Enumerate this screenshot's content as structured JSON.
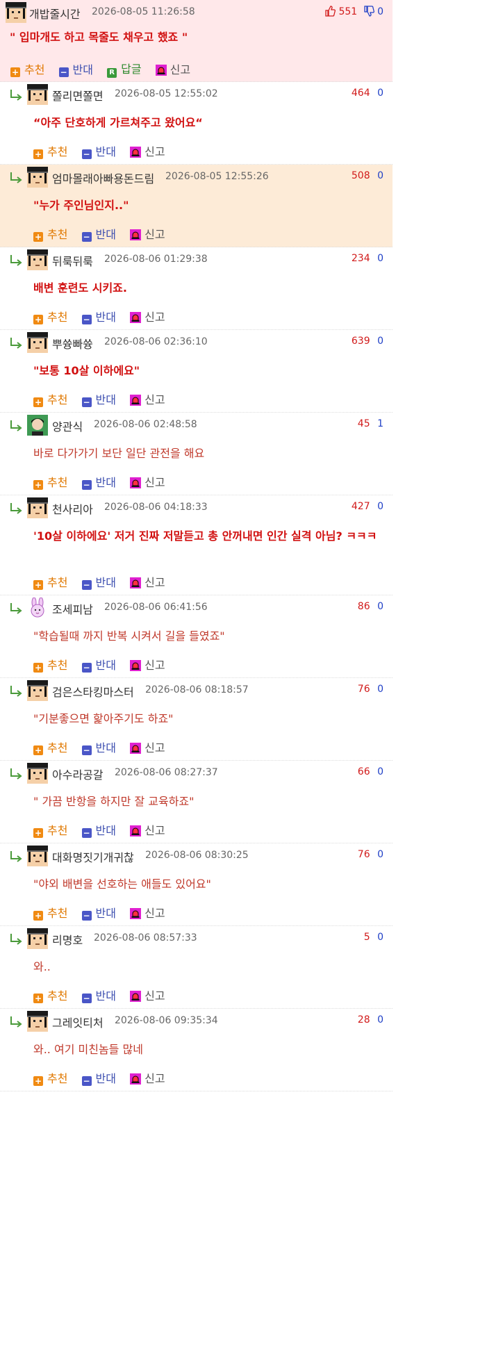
{
  "actions": {
    "recommend": "추천",
    "oppose": "반대",
    "reply": "답글",
    "report": "신고"
  },
  "comments": [
    {
      "type": "top",
      "nick": "개밥줄시간",
      "date": "2026-08-05 11:26:58",
      "up": "551",
      "down": "0",
      "text": "\" 입마개도 하고 목줄도 채우고 했죠 \"",
      "bold": true,
      "avatar": "default-avatar-icon"
    },
    {
      "type": "reply",
      "nick": "쫄리면쫄면",
      "date": "2026-08-05 12:55:02",
      "up": "464",
      "down": "0",
      "text": "“아주 단호하게 가르쳐주고 왔어요“",
      "bold": true,
      "avatar": "default-avatar-icon"
    },
    {
      "type": "reply",
      "nick": "엄마몰래아빠용돈드림",
      "date": "2026-08-05 12:55:26",
      "up": "508",
      "down": "0",
      "text": "\"누가 주인님인지..\"",
      "bold": true,
      "highlight": true,
      "avatar": "default-avatar-icon"
    },
    {
      "type": "reply",
      "nick": "뒤룩뒤룩",
      "date": "2026-08-06 01:29:38",
      "up": "234",
      "down": "0",
      "text": "배변 훈련도 시키죠.",
      "bold": true,
      "avatar": "default-avatar-icon"
    },
    {
      "type": "reply",
      "nick": "뿌쓩빠쓩",
      "date": "2026-08-06 02:36:10",
      "up": "639",
      "down": "0",
      "text": "\"보통 10살 이하에요\"",
      "bold": true,
      "avatar": "default-avatar-icon"
    },
    {
      "type": "reply",
      "nick": "양관식",
      "date": "2026-08-06 02:48:58",
      "up": "45",
      "down": "1",
      "text": "바로 다가가기 보단 일단 관전을 해요",
      "bold": false,
      "avatar": "photo-avatar-icon"
    },
    {
      "type": "reply",
      "nick": "천사리아",
      "date": "2026-08-06 04:18:33",
      "up": "427",
      "down": "0",
      "text": "'10살 이하에요' 저거 진짜 저말듣고 총 안꺼내면 인간 실격 아님? ㅋㅋㅋㅋㅋ",
      "bold": true,
      "twoLine": true,
      "avatar": "default-avatar-icon"
    },
    {
      "type": "reply",
      "nick": "조세피남",
      "date": "2026-08-06 06:41:56",
      "up": "86",
      "down": "0",
      "text": "\"학습될때 까지 반복 시켜서 길을 들였죠\"",
      "bold": false,
      "avatar": "bunny-avatar-icon"
    },
    {
      "type": "reply",
      "nick": "검은스타킹마스터",
      "date": "2026-08-06 08:18:57",
      "up": "76",
      "down": "0",
      "text": "\"기분좋으면 핥아주기도 하죠\"",
      "bold": false,
      "avatar": "default-avatar-icon"
    },
    {
      "type": "reply",
      "nick": "아수라공갈",
      "date": "2026-08-06 08:27:37",
      "up": "66",
      "down": "0",
      "text": "\" 가끔 반항을 하지만 잘 교육하죠\"",
      "bold": false,
      "avatar": "default-avatar-icon"
    },
    {
      "type": "reply",
      "nick": "대화명짓기개귀찮",
      "date": "2026-08-06 08:30:25",
      "up": "76",
      "down": "0",
      "text": "\"야외 배변을 선호하는 애들도 있어요\"",
      "bold": false,
      "avatar": "default-avatar-icon"
    },
    {
      "type": "reply",
      "nick": "리명호",
      "date": "2026-08-06 08:57:33",
      "up": "5",
      "down": "0",
      "text": "와..",
      "bold": false,
      "avatar": "default-avatar-icon"
    },
    {
      "type": "reply",
      "nick": "그레잇티처",
      "date": "2026-08-06 09:35:34",
      "up": "28",
      "down": "0",
      "text": "와.. 여기 미친놈들 많네",
      "bold": false,
      "avatar": "default-avatar-icon"
    }
  ]
}
